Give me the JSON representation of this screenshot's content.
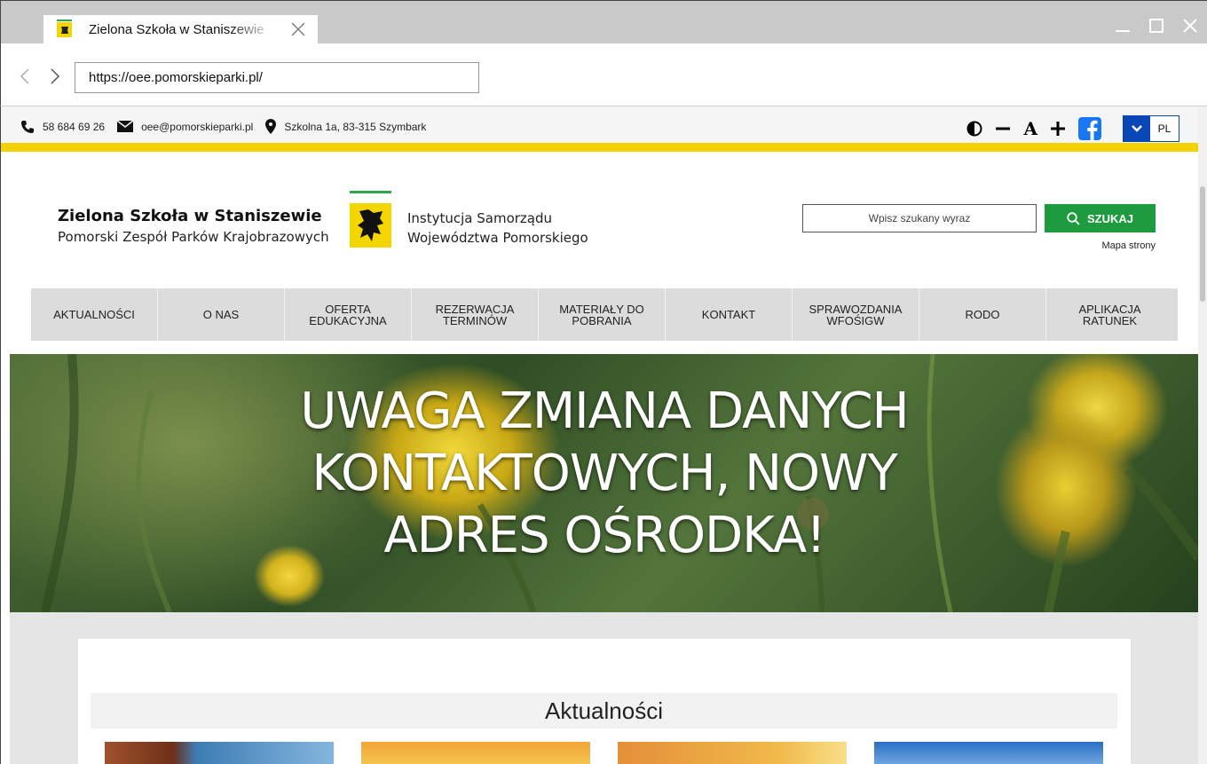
{
  "browser": {
    "tab_title": "Zielona Szkoła w Staniszewie",
    "url": "https://oee.pomorskieparki.pl/"
  },
  "topbar": {
    "phone": "58 684 69 26",
    "email": "oee@pomorskieparki.pl",
    "address": "Szkolna 1a, 83-315 Szymbark",
    "font_normal_label": "A",
    "language": "PL"
  },
  "header": {
    "brand_title": "Zielona Szkoła w Staniszewie",
    "brand_subtitle": "Pomorski Zespół Parków Krajobrazowych",
    "institution_line1": "Instytucja Samorządu",
    "institution_line2": "Województwa Pomorskiego",
    "search_placeholder": "Wpisz szukany wyraz",
    "search_button": "SZUKAJ",
    "sitemap": "Mapa strony"
  },
  "menu": {
    "items": [
      {
        "label": "AKTUALNOŚCI"
      },
      {
        "label": "O NAS"
      },
      {
        "label": "OFERTA EDUKACYJNA"
      },
      {
        "label": "REZERWACJA TERMINÓW"
      },
      {
        "label": "MATERIAŁY DO POBRANIA"
      },
      {
        "label": "KONTAKT"
      },
      {
        "label": "SPRAWOZDANIA WFOŚIGW"
      },
      {
        "label": "RODO"
      },
      {
        "label": "APLIKACJA RATUNEK"
      }
    ]
  },
  "hero": {
    "line1": "UWAGA ZMIANA DANYCH",
    "line2": "KONTAKTOWYCH, NOWY",
    "line3": "ADRES OŚRODKA!"
  },
  "news": {
    "heading": "Aktualności"
  },
  "colors": {
    "accent_yellow": "#f2d300",
    "search_green": "#1e9a3f",
    "lang_blue": "#0a47b6",
    "facebook_blue": "#1877f2"
  }
}
